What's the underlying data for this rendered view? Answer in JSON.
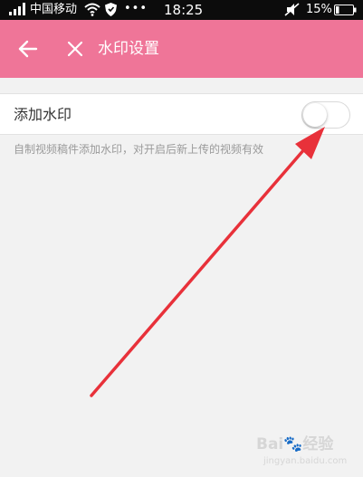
{
  "status_bar": {
    "carrier": "中国移动",
    "more": "•••",
    "time": "18:25",
    "battery_percent": "15%",
    "icons": [
      "signal-icon",
      "wifi-icon",
      "shield-icon",
      "mute-icon",
      "battery-icon"
    ]
  },
  "app_bar": {
    "title": "水印设置",
    "back_icon": "back-arrow-icon",
    "close_icon": "close-icon",
    "background_color": "#ef7598"
  },
  "setting": {
    "label": "添加水印",
    "enabled": false,
    "hint": "自制视频稿件添加水印，对开启后新上传的视频有效"
  },
  "watermark": {
    "logo": "Bai🐾经验",
    "url": "jingyan.baidu.com"
  },
  "annotation": {
    "type": "red-arrow",
    "color": "#e8313a",
    "points_to": "toggle-switch"
  }
}
